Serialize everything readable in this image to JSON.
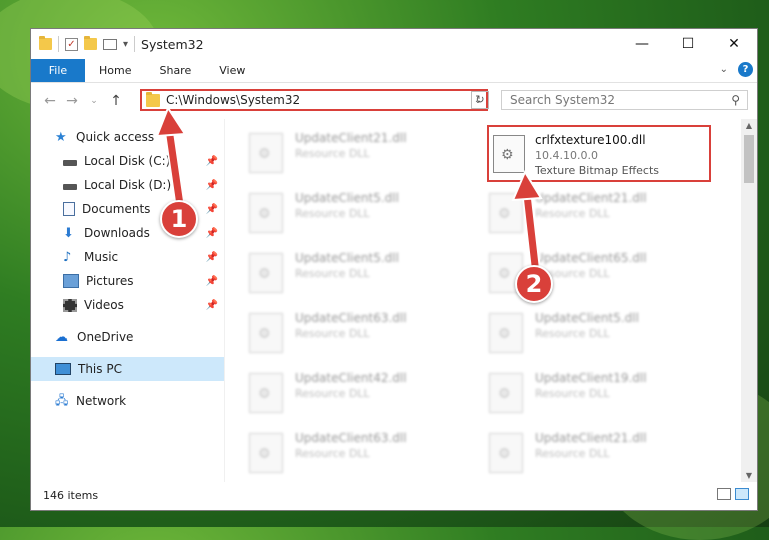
{
  "window": {
    "title": "System32",
    "controls": {
      "minimize": "—",
      "maximize": "☐",
      "close": "✕"
    }
  },
  "ribbon": {
    "tabs": [
      "File",
      "Home",
      "Share",
      "View"
    ],
    "help": "?"
  },
  "nav": {
    "address": "C:\\Windows\\System32",
    "search_placeholder": "Search System32"
  },
  "sidebar": {
    "quick_access": "Quick access",
    "pinned": [
      "Local Disk (C:)",
      "Local Disk (D:)",
      "Documents",
      "Downloads",
      "Music",
      "Pictures",
      "Videos"
    ],
    "onedrive": "OneDrive",
    "this_pc": "This PC",
    "network": "Network"
  },
  "files": {
    "highlighted": {
      "name": "crlfxtexture100.dll",
      "version": "10.4.10.0.0",
      "description": "Texture Bitmap Effects"
    },
    "left_column": [
      {
        "name": "UpdateClient21.dll",
        "desc": "Resource DLL"
      },
      {
        "name": "UpdateClient5.dll",
        "desc": "Resource DLL"
      },
      {
        "name": "UpdateClient5.dll",
        "desc": "Resource DLL"
      },
      {
        "name": "UpdateClient63.dll",
        "desc": "Resource DLL"
      },
      {
        "name": "UpdateClient42.dll",
        "desc": "Resource DLL"
      },
      {
        "name": "UpdateClient63.dll",
        "desc": "Resource DLL"
      }
    ],
    "right_column": [
      {
        "name": "UpdateClient21.dll",
        "desc": "Resource DLL"
      },
      {
        "name": "UpdateClient65.dll",
        "desc": "Resource DLL"
      },
      {
        "name": "UpdateClient5.dll",
        "desc": "Resource DLL"
      },
      {
        "name": "UpdateClient19.dll",
        "desc": "Resource DLL"
      },
      {
        "name": "UpdateClient21.dll",
        "desc": "Resource DLL"
      }
    ]
  },
  "status": {
    "items": "146 items"
  },
  "annotations": {
    "step1": "1",
    "step2": "2",
    "color": "#d9403a"
  }
}
